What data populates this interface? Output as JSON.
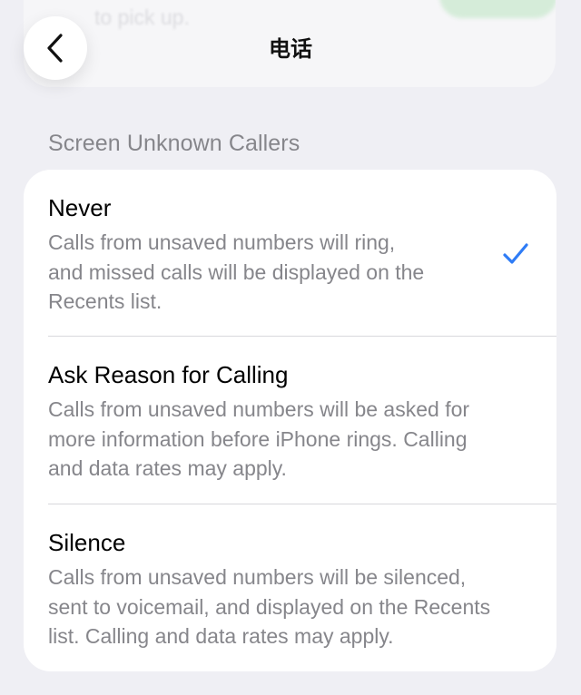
{
  "background_card": {
    "text": "phone will then notify you when it's\nto pick up.",
    "toggle_color": "#34c759"
  },
  "nav": {
    "title": "电话",
    "back_icon": "chevron-left-icon"
  },
  "section": {
    "header": "Screen Unknown Callers"
  },
  "options": [
    {
      "title": "Never",
      "description": "Calls from unsaved numbers will ring,\nand missed calls will be displayed on the\nRecents list.",
      "selected": true
    },
    {
      "title": "Ask Reason for Calling",
      "description": "Calls from unsaved numbers will be asked for\nmore information before iPhone rings. Calling\nand data rates may apply.",
      "selected": false
    },
    {
      "title": "Silence",
      "description": "Calls from unsaved numbers will be silenced,\nsent to voicemail, and displayed on the Recents\nlist. Calling and data rates may apply.",
      "selected": false
    }
  ],
  "colors": {
    "accent": "#2f7cf6",
    "background": "#efeff4",
    "secondary_text": "#86868b"
  }
}
